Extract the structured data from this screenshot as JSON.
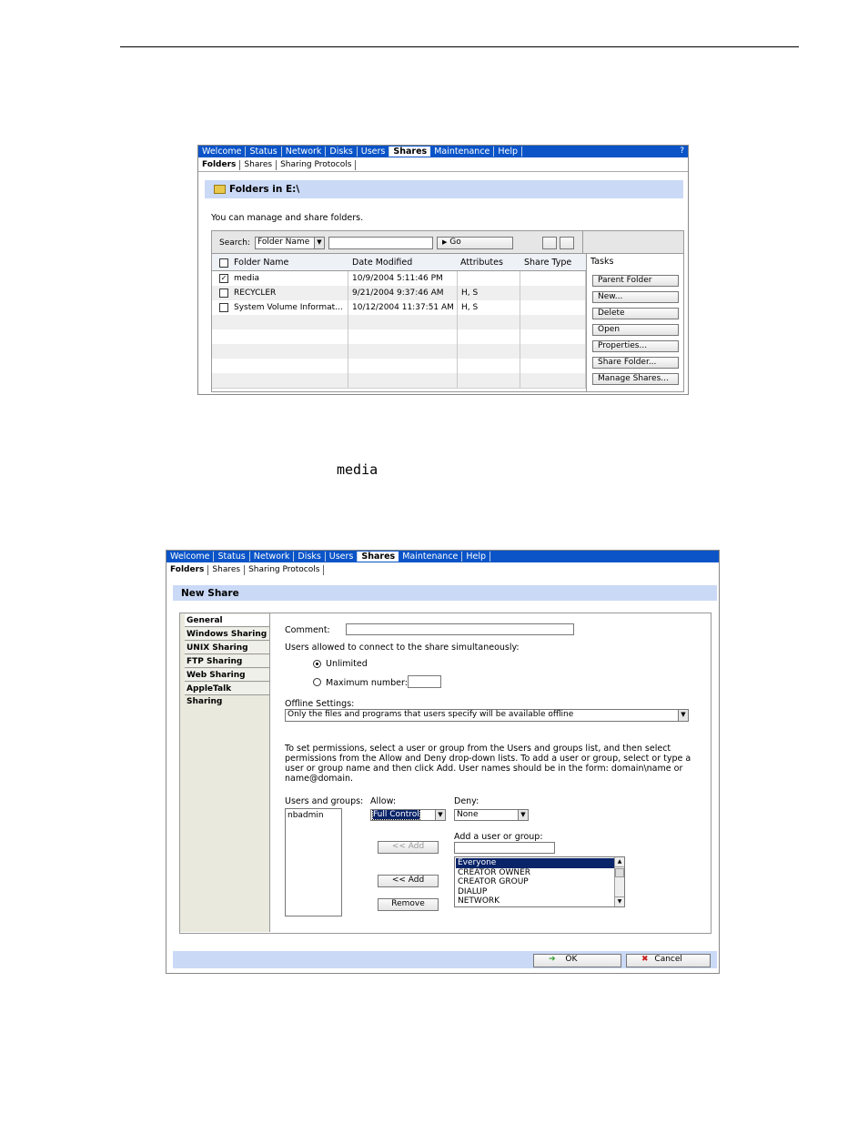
{
  "top": {
    "nav": [
      "Welcome",
      "Status",
      "Network",
      "Disks",
      "Users",
      "Shares",
      "Maintenance",
      "Help"
    ],
    "active_nav": "Shares",
    "help_mark": "?",
    "subtabs": [
      "Folders",
      "Shares",
      "Sharing Protocols"
    ],
    "panel_title": "Folders in E:\\",
    "description": "You can manage and share folders.",
    "search_label": "Search:",
    "search_field": "Folder Name",
    "go_label": "Go",
    "columns": [
      "Folder Name",
      "Date Modified",
      "Attributes",
      "Share Type"
    ],
    "tasks_label": "Tasks",
    "rows": [
      {
        "checked": "✓",
        "name": "media",
        "date": "10/9/2004 5:11:46 PM",
        "attr": "",
        "type": ""
      },
      {
        "checked": "",
        "name": "RECYCLER",
        "date": "9/21/2004 9:37:46 AM",
        "attr": "H, S",
        "type": ""
      },
      {
        "checked": "",
        "name": "System Volume Informat...",
        "date": "10/12/2004 11:37:51 AM",
        "attr": "H, S",
        "type": ""
      }
    ],
    "tasks": [
      "Parent Folder",
      "New...",
      "Delete",
      "Open",
      "Properties...",
      "Share Folder...",
      "Manage Shares..."
    ]
  },
  "caption_mono": "media",
  "bottom": {
    "nav": [
      "Welcome",
      "Status",
      "Network",
      "Disks",
      "Users",
      "Shares",
      "Maintenance",
      "Help"
    ],
    "active_nav": "Shares",
    "subtabs": [
      "Folders",
      "Shares",
      "Sharing Protocols"
    ],
    "panel_title": "New Share",
    "left_nav": [
      "General",
      "Windows Sharing",
      "UNIX Sharing",
      "FTP Sharing",
      "Web Sharing",
      "AppleTalk Sharing"
    ],
    "comment_label": "Comment:",
    "users_allowed_label": "Users allowed to connect to the share simultaneously:",
    "unlimited_label": "Unlimited",
    "maximum_label": "Maximum number:",
    "offline_label": "Offline Settings:",
    "offline_value": "Only the files and programs that users specify will be available offline",
    "perm_text_1": "To set permissions, select a user or group from the Users and groups list, and then select",
    "perm_text_2": "permissions from the Allow and Deny drop-down lists. To add a user or group, select or type a",
    "perm_text_3": "user or group name and then click Add. User names should be in the form: domain\\name or",
    "perm_text_4": "name@domain.",
    "users_groups_label": "Users and groups:",
    "users_groups": [
      "nbadmin"
    ],
    "allow_label": "Allow:",
    "allow_value": "Full Control",
    "deny_label": "Deny:",
    "deny_value": "None",
    "add_user_label": "Add a user or group:",
    "add_disabled": "<< Add",
    "add_label": "<< Add",
    "remove_label": "Remove",
    "group_list": [
      "Everyone",
      "CREATOR OWNER",
      "CREATOR GROUP",
      "DIALUP",
      "NETWORK"
    ],
    "ok_label": "OK",
    "cancel_label": "Cancel"
  },
  "colors": {
    "nav_blue": "#0a54c8",
    "title_blue": "#cad9f6",
    "select_blue": "#0a246a"
  }
}
